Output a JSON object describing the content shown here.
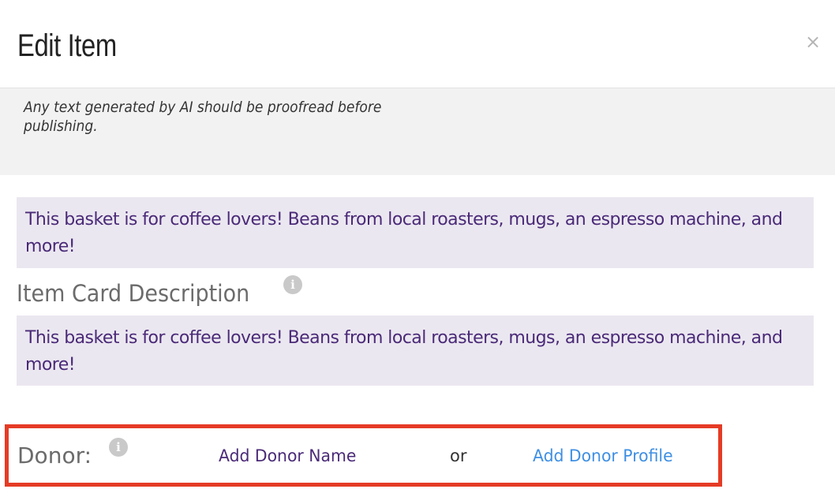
{
  "header": {
    "title": "Edit Item",
    "close_symbol": "×",
    "close_icon": "close-icon"
  },
  "notice": {
    "text": "Any text generated by AI should be proofread before publishing."
  },
  "description": {
    "text": "This basket is for coffee lovers! Beans from local roasters, mugs, an espresso machine, and more!"
  },
  "item_card_description": {
    "label": "Item Card Description",
    "info_symbol": "i",
    "info_icon": "info-icon",
    "text": "This basket is for coffee lovers! Beans from local roasters, mugs, an espresso machine, and more!"
  },
  "donor": {
    "label": "Donor:",
    "info_symbol": "i",
    "info_icon": "info-icon",
    "add_name_label": "Add Donor Name",
    "or_label": "or",
    "add_profile_label": "Add Donor Profile"
  },
  "colors": {
    "text_purple": "#4a2a78",
    "link_blue": "#3e8fe3",
    "highlight_red": "#e53b25",
    "box_background": "#ebe7f0",
    "notice_background": "#f2f2f2"
  }
}
